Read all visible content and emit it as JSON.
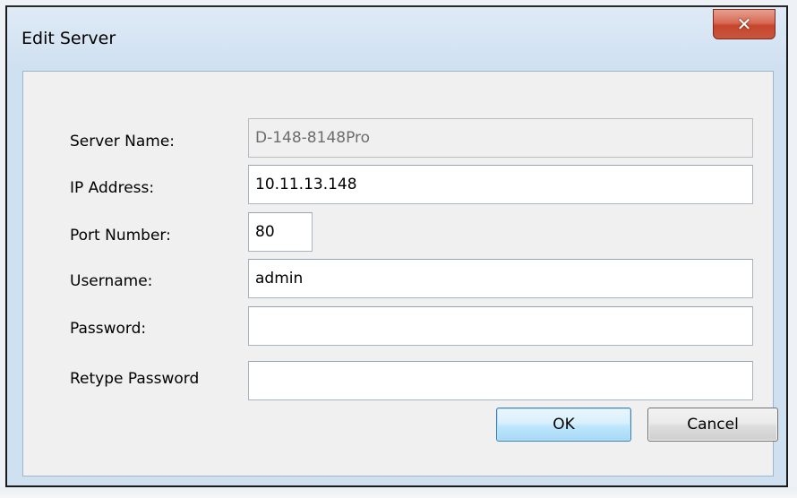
{
  "window": {
    "title": "Edit Server",
    "close_icon": "close-x-icon",
    "close_glyph": "✕"
  },
  "form": {
    "server_name": {
      "label": "Server Name:",
      "value": "D-148-8148Pro",
      "enabled": false
    },
    "ip_address": {
      "label": "IP Address:",
      "value": "10.11.13.148"
    },
    "port_number": {
      "label": "Port Number:",
      "value": "80"
    },
    "username": {
      "label": "Username:",
      "value": "admin"
    },
    "password": {
      "label": "Password:",
      "value": ""
    },
    "retype_password": {
      "label": "Retype Password",
      "value": ""
    }
  },
  "buttons": {
    "ok": "OK",
    "cancel": "Cancel"
  },
  "colors": {
    "frame": "#cfe0f1",
    "close_button": "#c7452d",
    "ok_button_border": "#3c7fb1"
  }
}
